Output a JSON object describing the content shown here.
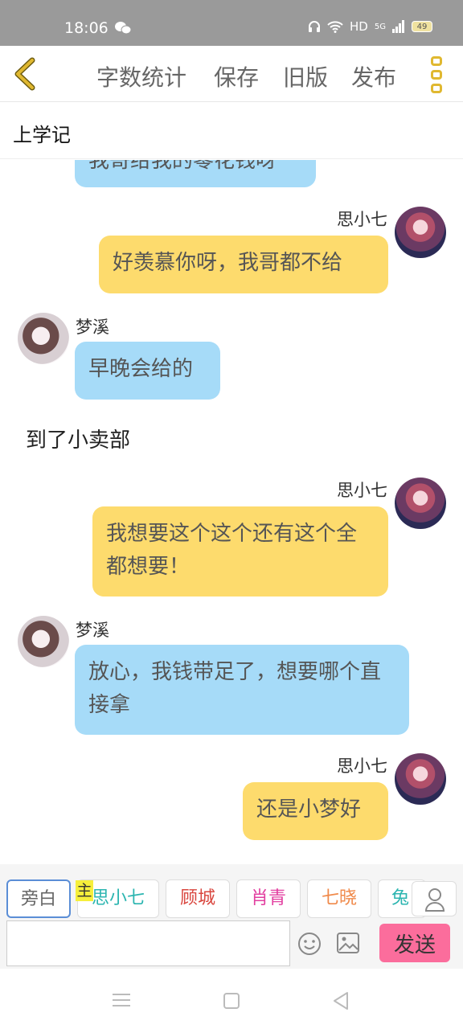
{
  "status_bar": {
    "time": "18:06",
    "network": "HD",
    "signal": "5G",
    "battery": "49"
  },
  "toolbar": {
    "word_count": "字数统计",
    "save": "保存",
    "old_version": "旧版",
    "publish": "发布"
  },
  "title": "上学记",
  "messages": [
    {
      "type": "left",
      "text": "我哥给我的零花钱呀",
      "partial": true
    },
    {
      "type": "right",
      "name": "思小七",
      "text": "好羡慕你呀，我哥都不给"
    },
    {
      "type": "left",
      "name": "梦溪",
      "text": "早晚会给的"
    },
    {
      "type": "narration",
      "text": "到了小卖部"
    },
    {
      "type": "right",
      "name": "思小七",
      "text": "我想要这个这个还有这个全都想要！"
    },
    {
      "type": "left",
      "name": "梦溪",
      "text": "放心，我钱带足了，想要哪个直接拿"
    },
    {
      "type": "right",
      "name": "思小七",
      "text": "还是小梦好"
    }
  ],
  "roles": [
    {
      "label": "旁白",
      "color": "#666666",
      "active": true
    },
    {
      "label": "思小七",
      "color": "#2bb5b0",
      "host": true
    },
    {
      "label": "顾城",
      "color": "#d9463e"
    },
    {
      "label": "肖青",
      "color": "#e23fa0"
    },
    {
      "label": "七晓",
      "color": "#f08a4b"
    },
    {
      "label": "兔",
      "color": "#2bb5b0"
    }
  ],
  "host_tag": "主",
  "input": {
    "value": "",
    "placeholder": ""
  },
  "send_label": "发送",
  "colors": {
    "accent": "#e0b830",
    "bubble_blue": "#a6dbf8",
    "bubble_yellow": "#fddb6d",
    "send": "#fb6d9c"
  }
}
